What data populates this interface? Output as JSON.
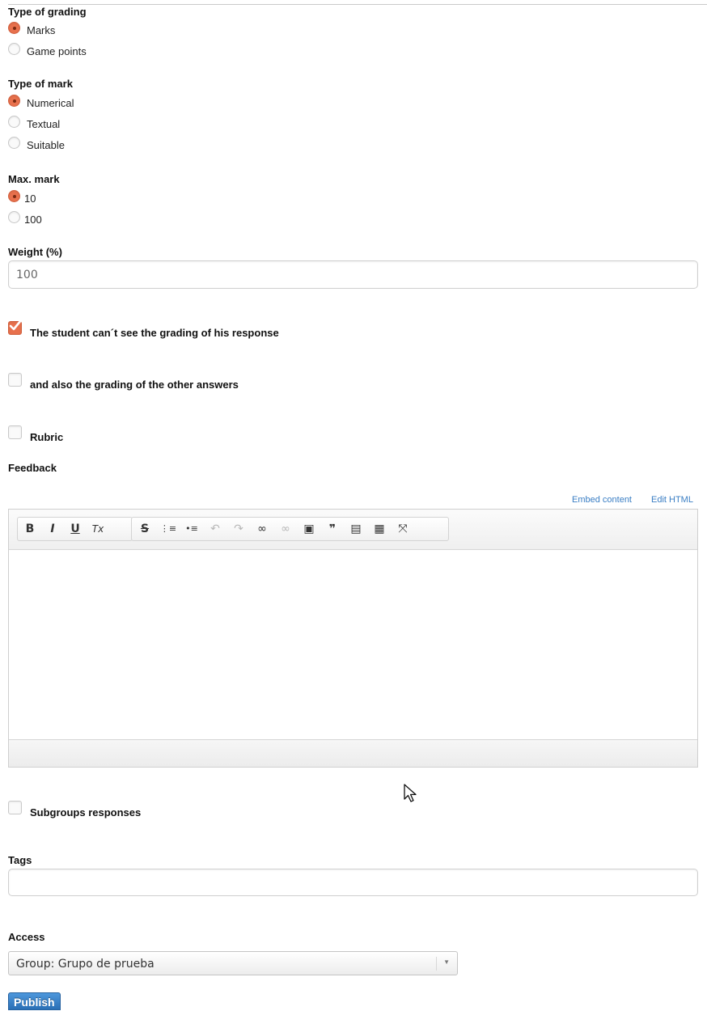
{
  "grading": {
    "label": "Type of grading",
    "options": [
      {
        "label": "Marks",
        "selected": true
      },
      {
        "label": "Game points",
        "selected": false
      }
    ]
  },
  "mark_type": {
    "label": "Type of mark",
    "options": [
      {
        "label": "Numerical",
        "selected": true
      },
      {
        "label": "Textual",
        "selected": false
      },
      {
        "label": "Suitable",
        "selected": false
      }
    ]
  },
  "max_mark": {
    "label": "Max. mark",
    "options": [
      {
        "label": "10",
        "selected": true
      },
      {
        "label": "100",
        "selected": false
      }
    ]
  },
  "weight": {
    "label": "Weight (%)",
    "value": "100"
  },
  "checkboxes": {
    "hide_own_grading": {
      "label": "The student can´t see the grading of his response",
      "checked": true
    },
    "hide_other_grading": {
      "label": "and also the grading of the other answers",
      "checked": false
    },
    "rubric": {
      "label": "Rubric",
      "checked": false
    },
    "subgroups": {
      "label": "Subgroups responses",
      "checked": false
    }
  },
  "feedback": {
    "label": "Feedback",
    "embed_link": "Embed content",
    "edit_html_link": "Edit HTML",
    "toolbar_icons": [
      "bold-icon",
      "italic-icon",
      "underline-icon",
      "remove-format-icon",
      "strikethrough-icon",
      "numbered-list-icon",
      "bulleted-list-icon",
      "undo-icon",
      "redo-icon",
      "link-icon",
      "unlink-icon",
      "image-icon",
      "blockquote-icon",
      "paste-text-icon",
      "paste-word-icon",
      "maximize-icon"
    ],
    "toolbar_glyphs": {
      "bold": "B",
      "italic": "I",
      "underline": "U",
      "clear": "Tx",
      "strike": "S",
      "numbered": "⋮≡",
      "bulleted": "•≡",
      "undo": "↶",
      "redo": "↷",
      "link": "∞",
      "unlink": "∞",
      "image": "▣",
      "quote": "❞",
      "paste_text": "▤",
      "paste_word": "▦",
      "maximize": "⤧"
    }
  },
  "tags": {
    "label": "Tags",
    "value": ""
  },
  "access": {
    "label": "Access",
    "selected": "Group: Grupo de prueba"
  },
  "publish_label": "Publish",
  "colors": {
    "accent": "#e8714d",
    "link": "#3a7ec4",
    "button": "#2a6fb5"
  }
}
